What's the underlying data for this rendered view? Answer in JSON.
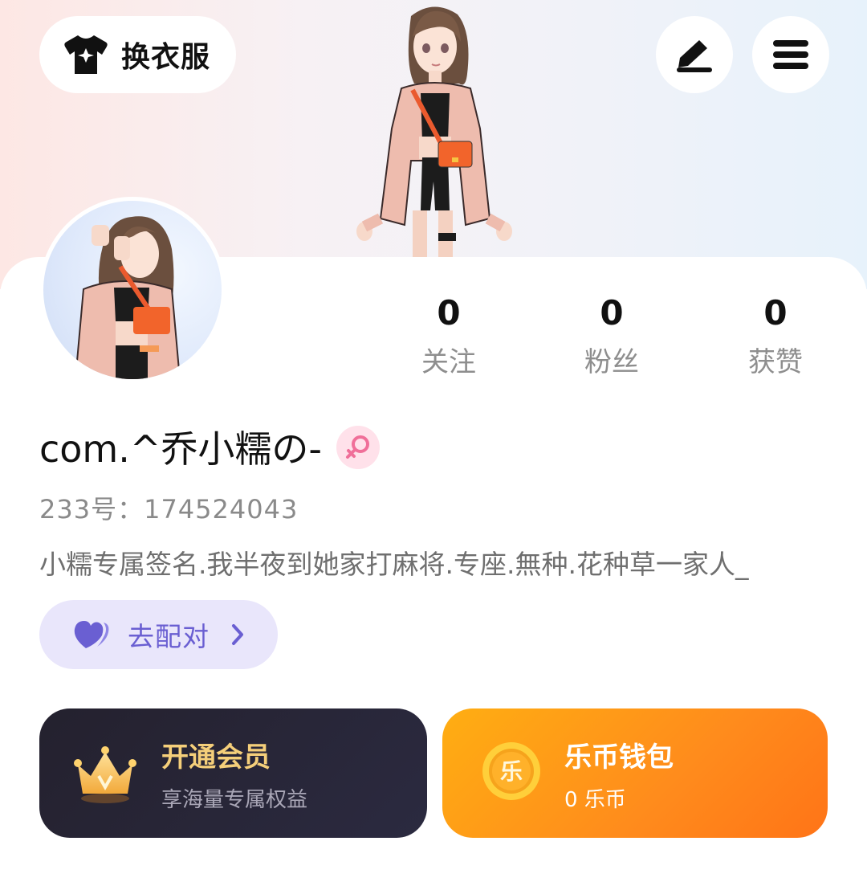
{
  "header": {
    "change_outfit_label": "换衣服",
    "icons": {
      "outfit": "tshirt-sparkle-icon",
      "edit": "pencil-icon",
      "menu": "hamburger-menu-icon"
    }
  },
  "profile": {
    "name": "com.^乔小糯の-",
    "gender_icon": "female-icon",
    "uid": "233号：174524043",
    "bio": "小糯专属签名.我半夜到她家打麻将.专座.無种.花种草一家人_",
    "stats": [
      {
        "value": "0",
        "label": "关注"
      },
      {
        "value": "0",
        "label": "粉丝"
      },
      {
        "value": "0",
        "label": "获赞"
      }
    ]
  },
  "match_button": {
    "label": "去配对",
    "icon": "hearts-icon"
  },
  "tiles": {
    "vip": {
      "title": "开通会员",
      "subtitle": "享海量专属权益",
      "icon": "crown-icon"
    },
    "wallet": {
      "title": "乐币钱包",
      "subtitle": "0 乐币",
      "icon_text": "乐",
      "icon": "coin-icon"
    }
  },
  "colors": {
    "match_bg": "#e9e6fb",
    "match_text": "#6a5fd2",
    "vip_bg": "#24212e",
    "vip_title": "#f5cf7a",
    "wallet_bg": "#ff9a16",
    "gender_bg": "#ffe1ea",
    "gender_fg": "#f06f99"
  }
}
